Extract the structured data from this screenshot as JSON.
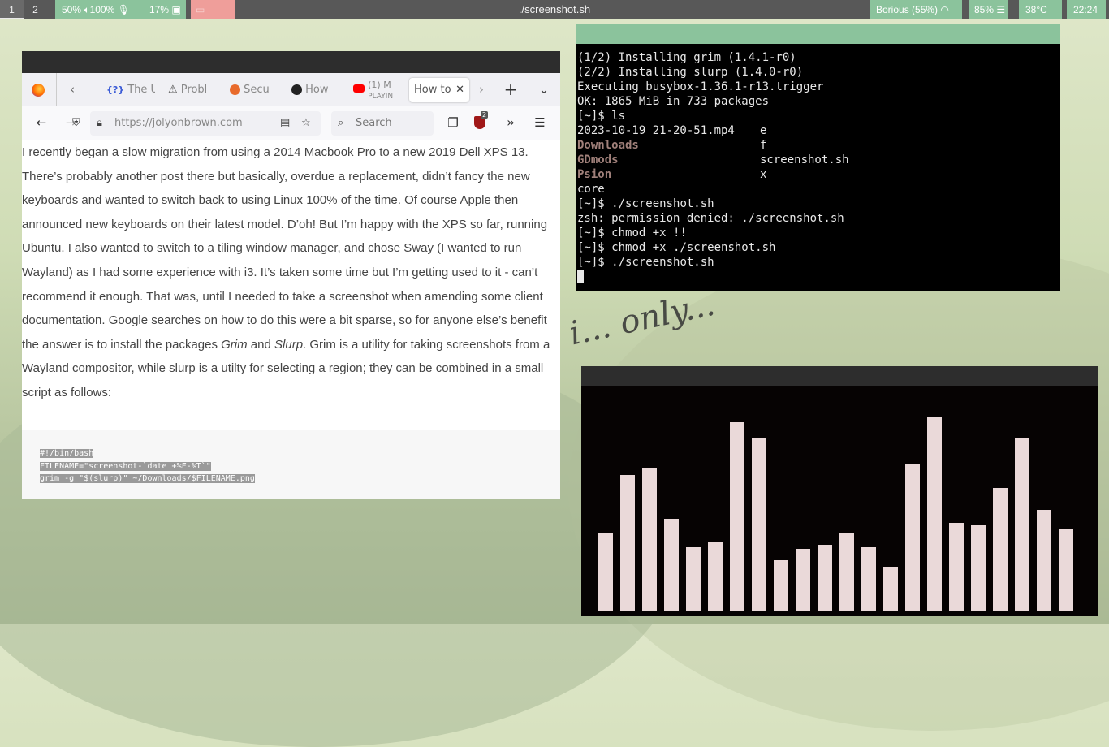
{
  "topbar": {
    "workspaces": [
      "1",
      "2"
    ],
    "audio": "50%",
    "volume": "100%",
    "cpu": "17%",
    "window_title": "./screenshot.sh",
    "wifi": "Borious (55%)",
    "battery": "85%",
    "temp": "38°C",
    "clock": "22:24",
    "accent_color": "#8bc39c",
    "alert_color": "#ef9e9a"
  },
  "browser": {
    "tabs": [
      {
        "label": "The U",
        "icon": "code-icon"
      },
      {
        "label": "Probl",
        "icon": "warning-icon"
      },
      {
        "label": "Secu",
        "icon": "firefox-icon"
      },
      {
        "label": "How",
        "icon": "github-icon"
      },
      {
        "label": "(1) M",
        "sub": "PLAYIN",
        "icon": "youtube-icon"
      },
      {
        "label": "How to",
        "icon": ""
      }
    ],
    "url": "https://jolyonbrown.com",
    "search_placeholder": "Search",
    "badge_count": "2",
    "article": {
      "p1a": "I recently began a slow migration from using a 2014 Macbook Pro to a new 2019 Dell XPS 13. There’s probably another post there but basically, overdue a replacement, didn’t fancy the new keyboards and wanted to switch back to using Linux 100% of the time. Of course Apple then announced new keyboards on their latest model. D’oh! But I’m happy with the XPS so far, running Ubuntu. I also wanted to switch to a tiling window manager, and chose Sway (I wanted to run Wayland) as I had some experience with i3. It’s taken some time but I’m getting used to it - can’t recommend it enough. That was, until I needed to take a screenshot when amending some client documentation. Google searches on how to do this were a bit sparse, so for anyone else’s benefit the answer is to install the packages ",
      "grim": "Grim",
      "and": " and ",
      "slurp": "Slurp",
      "p1b": ". Grim is a utility for taking screenshots from a Wayland compositor, while slurp is a utilty for selecting a region; they can be combined in a small script as follows:"
    },
    "code": [
      "#!/bin/bash",
      "FILENAME=\"screenshot-`date +%F-%T`\"",
      "grim -g \"$(slurp)\" ~/Downloads/$FILENAME.png"
    ]
  },
  "terminal": {
    "lines": [
      "(1/2) Installing grim (1.4.1-r0)",
      "(2/2) Installing slurp (1.4.0-r0)",
      "Executing busybox-1.36.1-r13.trigger",
      "OK: 1865 MiB in 733 packages"
    ],
    "prompt": "[~]$ ",
    "cmd_ls": "ls",
    "ls_rows": [
      {
        "left": "2023-10-19 21-20-51.mp4",
        "left_dir": false,
        "right": "e"
      },
      {
        "left": "Downloads",
        "left_dir": true,
        "right": "f"
      },
      {
        "left": "GDmods",
        "left_dir": true,
        "right": "screenshot.sh"
      },
      {
        "left": "Psion",
        "left_dir": true,
        "right": "x"
      },
      {
        "left": "core",
        "left_dir": false,
        "right": ""
      }
    ],
    "cmd_run1": "./screenshot.sh",
    "error": "zsh: permission denied: ./screenshot.sh",
    "cmd_chmod1": "chmod +x !!",
    "cmd_chmod2": "chmod +x ./screenshot.sh",
    "cmd_run2": "./screenshot.sh"
  },
  "visualizer": {
    "levels": [
      0.35,
      0.62,
      0.65,
      0.42,
      0.29,
      0.31,
      0.86,
      0.79,
      0.23,
      0.28,
      0.3,
      0.35,
      0.29,
      0.2,
      0.67,
      0.88,
      0.4,
      0.39,
      0.56,
      0.79,
      0.46,
      0.37
    ]
  },
  "wallpaper": {
    "text": "i... only..."
  }
}
